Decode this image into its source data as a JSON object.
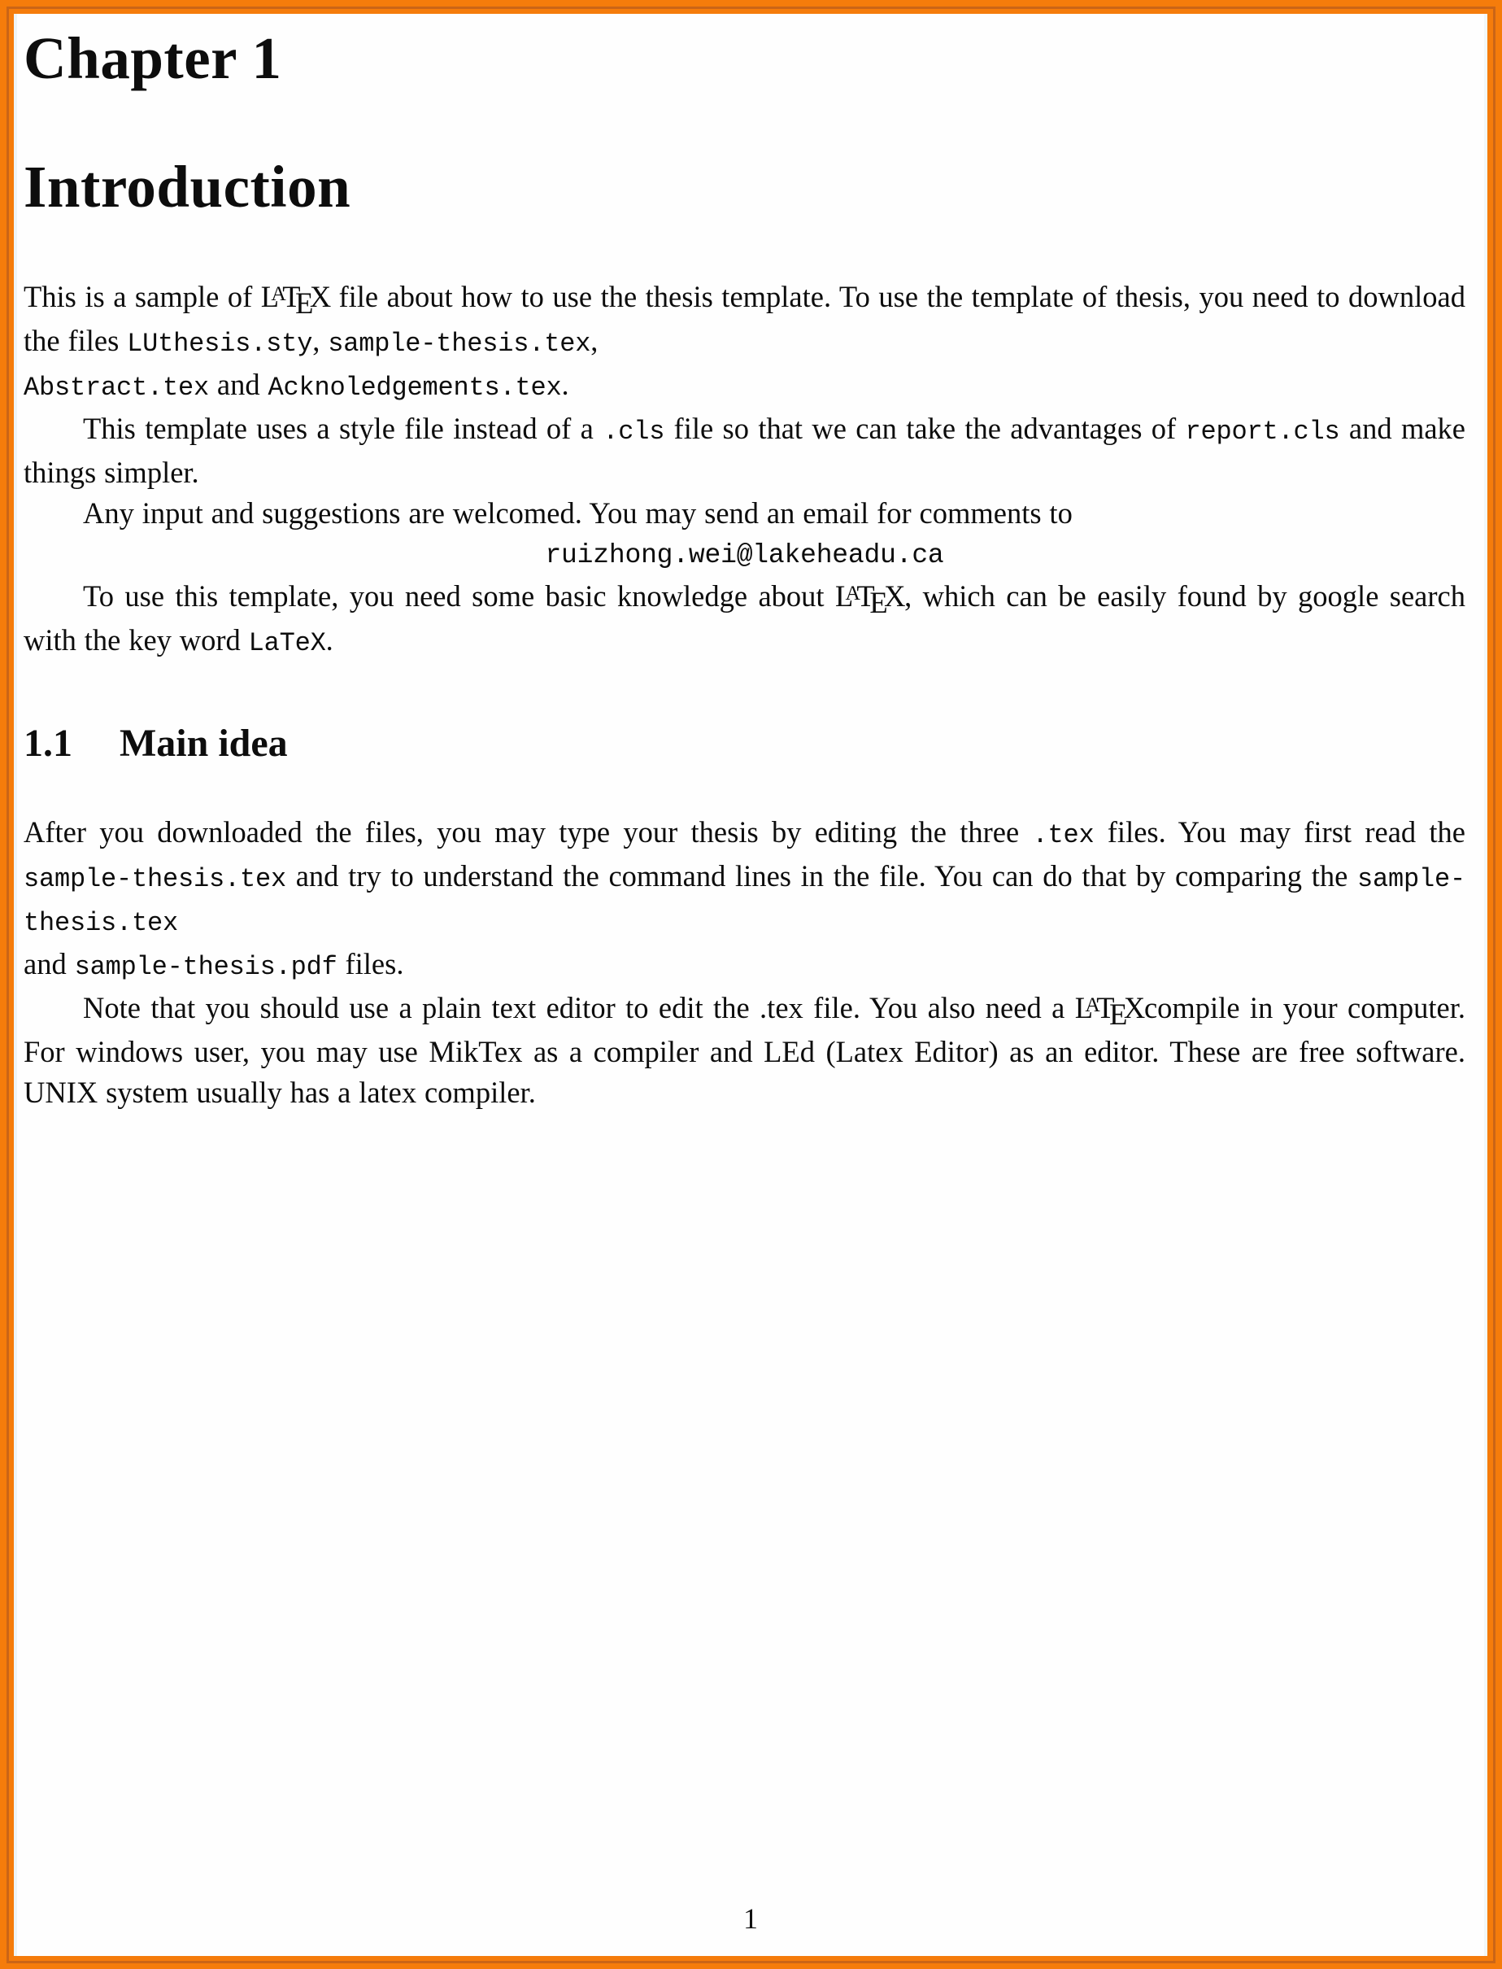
{
  "document": {
    "chapter_number": "Chapter 1",
    "chapter_title": "Introduction",
    "page_number": "1",
    "border_color": "#f57c0b",
    "border_inner_color": "#c2621a",
    "paper_color": "#fefefe",
    "text_color": "#0d0d0d"
  },
  "intro": {
    "p1_a": "This is a sample of ",
    "p1_latex": "LaTeX",
    "p1_b": " file about how to use the thesis template. To use the template of thesis, you need to download the files ",
    "p1_file1": "LUthesis.sty",
    "p1_c": ", ",
    "p1_file2": "sample-thesis.tex",
    "p1_d": ", ",
    "p1_file3": "Abstract.tex",
    "p1_e": " and ",
    "p1_file4": "Acknoledgements.tex",
    "p1_f": ".",
    "p2_a": "This template uses a style file instead of a ",
    "p2_file1": ".cls",
    "p2_b": " file so that we can take the advantages of ",
    "p2_file2": "report.cls",
    "p2_c": " and make things simpler.",
    "p3": "Any input and suggestions are welcomed. You may send an email for comments to",
    "email": "ruizhong.wei@lakeheadu.ca",
    "p4_a": "To use this template, you need some basic knowledge about ",
    "p4_latex": "LaTeX",
    "p4_b": ", which can be easily found by google search with the key word ",
    "p4_keyword": "LaTeX",
    "p4_c": "."
  },
  "section_main_idea": {
    "number": "1.1",
    "title": "Main idea",
    "p1_a": "After you downloaded the files, you may type your thesis by editing the three ",
    "p1_ext": ".tex",
    "p1_b": " files. You may first read the ",
    "p1_file1": "sample-thesis.tex",
    "p1_c": " and try to understand the command lines in the file. You can do that by comparing the ",
    "p1_file2": "sample-thesis.tex",
    "p1_d": " and ",
    "p1_file3": "sample-thesis.pdf",
    "p1_e": " files.",
    "p2_a": "Note that you should use a plain text editor to edit the .tex file. You also need a ",
    "p2_latex": "LaTeX",
    "p2_b": "compile in your computer. For windows user, you may use MikTex as a compiler and LEd (Latex Editor) as an editor. These are free software. UNIX system usually has a latex compiler."
  }
}
